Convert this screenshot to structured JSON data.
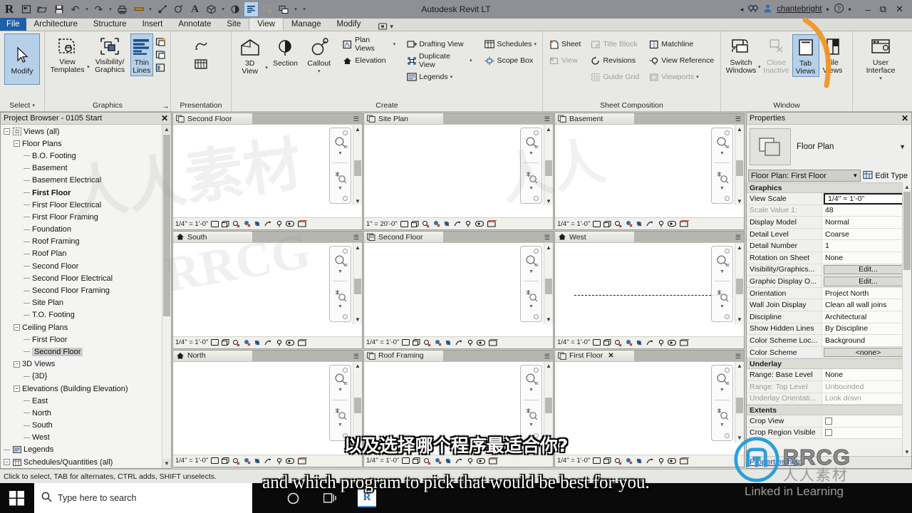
{
  "window": {
    "app_title": "Autodesk Revit LT",
    "user_name": "chantebright",
    "minimize": "–",
    "restore": "❐",
    "close": "✕",
    "help_icon": "?",
    "search_icon": "search-icon"
  },
  "quick_access": {
    "items": [
      {
        "name": "revit-logo",
        "glyph": "R"
      },
      {
        "name": "new-icon",
        "glyph": "◱"
      },
      {
        "name": "open-icon",
        "glyph": "☁"
      },
      {
        "name": "save-icon",
        "glyph": "Ὃe"
      },
      {
        "name": "undo-icon",
        "glyph": "↶"
      },
      {
        "name": "redo-icon",
        "glyph": "↷"
      },
      {
        "name": "print-icon",
        "glyph": "⎙"
      },
      {
        "name": "measure-icon",
        "glyph": "↔"
      },
      {
        "name": "aligned-dimension-icon",
        "glyph": "↗"
      },
      {
        "name": "tag-icon",
        "glyph": "℘"
      },
      {
        "name": "text-icon",
        "glyph": "A"
      },
      {
        "name": "default-3d-view-icon",
        "glyph": "⬡"
      },
      {
        "name": "section-icon",
        "glyph": "◔"
      },
      {
        "name": "thin-lines-icon",
        "glyph": "☰"
      },
      {
        "name": "close-hidden-windows-icon",
        "glyph": "❑"
      },
      {
        "name": "switch-windows-icon",
        "glyph": "⧉"
      },
      {
        "name": "customize-qat-icon",
        "glyph": "▾"
      }
    ]
  },
  "ribbon_tabs": {
    "file": "File",
    "items": [
      "Architecture",
      "Structure",
      "Insert",
      "Annotate",
      "Site",
      "View",
      "Manage",
      "Modify"
    ],
    "active": "View",
    "contextual_glyph": "▣"
  },
  "ribbon": {
    "panels": [
      {
        "name": "select",
        "title": "Select",
        "has_dropdown": true,
        "buttons": [
          {
            "label_line1": "Modify",
            "label_line2": "",
            "active": true,
            "icon": "arrow-cursor-icon"
          }
        ]
      },
      {
        "name": "graphics",
        "title": "Graphics",
        "has_launcher": true,
        "buttons": [
          {
            "label_line1": "View",
            "label_line2": "Templates",
            "active": false,
            "icon": "view-templates-icon",
            "caret": true
          },
          {
            "label_line1": "Visibility/",
            "label_line2": "Graphics",
            "active": false,
            "icon": "visibility-graphics-icon"
          },
          {
            "label_line1": "Thin",
            "label_line2": "Lines",
            "active": true,
            "icon": "thin-lines-icon"
          }
        ],
        "stack": [
          "show-hidden-lines-icon",
          "remove-hidden-lines-icon",
          "cut-profile-icon"
        ]
      },
      {
        "name": "presentation",
        "title": "Presentation",
        "stack": [
          "render-icon",
          "render-gallery-icon"
        ]
      },
      {
        "name": "create",
        "title": "Create",
        "buttons": [
          {
            "label_line1": "3D",
            "label_line2": "View",
            "icon": "3d-view-icon",
            "caret": true
          },
          {
            "label_line1": "Section",
            "label_line2": "",
            "icon": "section-icon"
          },
          {
            "label_line1": "Callout",
            "label_line2": "",
            "icon": "callout-icon",
            "caret": true
          }
        ],
        "small_cols": [
          [
            {
              "label": "Plan Views",
              "icon": "plan-views-icon",
              "caret": true,
              "dim": false
            },
            {
              "label": "Elevation",
              "icon": "elevation-icon",
              "caret": false,
              "dim": false
            }
          ],
          [
            {
              "label": "Drafting View",
              "icon": "drafting-view-icon",
              "caret": false,
              "dim": false
            },
            {
              "label": "Duplicate View",
              "icon": "duplicate-view-icon",
              "caret": true,
              "dim": false
            },
            {
              "label": "Legends",
              "icon": "legends-icon",
              "caret": true,
              "dim": false
            }
          ],
          [
            {
              "label": "Schedules",
              "icon": "schedules-icon",
              "caret": true,
              "dim": false
            },
            {
              "label": "Scope Box",
              "icon": "scope-box-icon",
              "caret": false,
              "dim": false
            }
          ]
        ]
      },
      {
        "name": "sheet-composition",
        "title": "Sheet Composition",
        "small_cols": [
          [
            {
              "label": "Sheet",
              "icon": "sheet-icon",
              "caret": false,
              "dim": false
            },
            {
              "label": "View",
              "icon": "view-icon",
              "caret": false,
              "dim": true
            }
          ],
          [
            {
              "label": "Title Block",
              "icon": "title-block-icon",
              "caret": false,
              "dim": true
            },
            {
              "label": "Revisions",
              "icon": "revisions-icon",
              "caret": false,
              "dim": false
            },
            {
              "label": "Guide Grid",
              "icon": "guide-grid-icon",
              "caret": false,
              "dim": true
            }
          ],
          [
            {
              "label": "Matchline",
              "icon": "matchline-icon",
              "caret": false,
              "dim": false
            },
            {
              "label": "View Reference",
              "icon": "view-reference-icon",
              "caret": false,
              "dim": false
            },
            {
              "label": "Viewports",
              "icon": "viewports-icon",
              "caret": true,
              "dim": true
            }
          ]
        ]
      },
      {
        "name": "window",
        "title": "Window",
        "buttons": [
          {
            "label_line1": "Switch",
            "label_line2": "Windows",
            "icon": "switch-windows-icon",
            "caret": true
          },
          {
            "label_line1": "Close",
            "label_line2": "Inactive",
            "icon": "close-inactive-icon",
            "dim": true
          },
          {
            "label_line1": "Tab",
            "label_line2": "Views",
            "icon": "tab-views-icon",
            "active": true
          },
          {
            "label_line1": "Tile",
            "label_line2": "Views",
            "icon": "tile-views-icon"
          }
        ]
      },
      {
        "name": "user-interface",
        "title": "",
        "buttons": [
          {
            "label_line1": "User",
            "label_line2": "Interface",
            "icon": "user-interface-icon",
            "caret": true
          }
        ]
      }
    ]
  },
  "browser": {
    "title": "Project Browser - 0105 Start",
    "close_glyph": "✕",
    "nodes": [
      {
        "label": "Views (all)",
        "depth": 0,
        "expander": "−",
        "icon": "views-all-icon",
        "bold": false,
        "selected": false
      },
      {
        "label": "Floor Plans",
        "depth": 1,
        "expander": "−",
        "icon": "",
        "bold": false,
        "selected": false
      },
      {
        "label": "B.O. Footing",
        "depth": 2,
        "expander": "",
        "icon": "",
        "bold": false,
        "selected": false
      },
      {
        "label": "Basement",
        "depth": 2,
        "expander": "",
        "icon": "",
        "bold": false,
        "selected": false
      },
      {
        "label": "Basement Electrical",
        "depth": 2,
        "expander": "",
        "icon": "",
        "bold": false,
        "selected": false
      },
      {
        "label": "First Floor",
        "depth": 2,
        "expander": "",
        "icon": "",
        "bold": true,
        "selected": false
      },
      {
        "label": "First Floor Electrical",
        "depth": 2,
        "expander": "",
        "icon": "",
        "bold": false,
        "selected": false
      },
      {
        "label": "First Floor Framing",
        "depth": 2,
        "expander": "",
        "icon": "",
        "bold": false,
        "selected": false
      },
      {
        "label": "Foundation",
        "depth": 2,
        "expander": "",
        "icon": "",
        "bold": false,
        "selected": false
      },
      {
        "label": "Roof Framing",
        "depth": 2,
        "expander": "",
        "icon": "",
        "bold": false,
        "selected": false
      },
      {
        "label": "Roof Plan",
        "depth": 2,
        "expander": "",
        "icon": "",
        "bold": false,
        "selected": false
      },
      {
        "label": "Second Floor",
        "depth": 2,
        "expander": "",
        "icon": "",
        "bold": false,
        "selected": false
      },
      {
        "label": "Second Floor Electrical",
        "depth": 2,
        "expander": "",
        "icon": "",
        "bold": false,
        "selected": false
      },
      {
        "label": "Second Floor Framing",
        "depth": 2,
        "expander": "",
        "icon": "",
        "bold": false,
        "selected": false
      },
      {
        "label": "Site Plan",
        "depth": 2,
        "expander": "",
        "icon": "",
        "bold": false,
        "selected": false
      },
      {
        "label": "T.O. Footing",
        "depth": 2,
        "expander": "",
        "icon": "",
        "bold": false,
        "selected": false
      },
      {
        "label": "Ceiling Plans",
        "depth": 1,
        "expander": "−",
        "icon": "",
        "bold": false,
        "selected": false
      },
      {
        "label": "First Floor",
        "depth": 2,
        "expander": "",
        "icon": "",
        "bold": false,
        "selected": false
      },
      {
        "label": "Second Floor",
        "depth": 2,
        "expander": "",
        "icon": "",
        "bold": false,
        "selected": true
      },
      {
        "label": "3D Views",
        "depth": 1,
        "expander": "−",
        "icon": "",
        "bold": false,
        "selected": false
      },
      {
        "label": "{3D}",
        "depth": 2,
        "expander": "",
        "icon": "",
        "bold": false,
        "selected": false
      },
      {
        "label": "Elevations (Building Elevation)",
        "depth": 1,
        "expander": "−",
        "icon": "",
        "bold": false,
        "selected": false
      },
      {
        "label": "East",
        "depth": 2,
        "expander": "",
        "icon": "",
        "bold": false,
        "selected": false
      },
      {
        "label": "North",
        "depth": 2,
        "expander": "",
        "icon": "",
        "bold": false,
        "selected": false
      },
      {
        "label": "South",
        "depth": 2,
        "expander": "",
        "icon": "",
        "bold": false,
        "selected": false
      },
      {
        "label": "West",
        "depth": 2,
        "expander": "",
        "icon": "",
        "bold": false,
        "selected": false
      },
      {
        "label": "Legends",
        "depth": 0,
        "expander": "",
        "icon": "legends-icon",
        "bold": false,
        "selected": false
      },
      {
        "label": "Schedules/Quantities (all)",
        "depth": 0,
        "expander": "−",
        "icon": "schedules-icon",
        "bold": false,
        "selected": false
      }
    ]
  },
  "views": [
    {
      "title": "Second Floor",
      "icon": "floor-plan-icon",
      "scale": "1/4\" = 1'-0\"",
      "closeable": false,
      "has_line": false
    },
    {
      "title": "Site Plan",
      "icon": "floor-plan-icon",
      "scale": "1\" = 20'-0\"",
      "closeable": false,
      "has_line": false
    },
    {
      "title": "Basement",
      "icon": "floor-plan-icon",
      "scale": "1/4\" = 1'-0\"",
      "closeable": false,
      "has_line": false
    },
    {
      "title": "South",
      "icon": "elevation-icon",
      "scale": "1/4\" = 1'-0\"",
      "closeable": false,
      "has_line": false
    },
    {
      "title": "Second Floor",
      "icon": "ceiling-plan-icon",
      "scale": "1/4\" = 1'-0\"",
      "closeable": false,
      "has_line": false
    },
    {
      "title": "West",
      "icon": "elevation-icon",
      "scale": "1/4\" = 1'-0\"",
      "closeable": false,
      "has_line": true
    },
    {
      "title": "North",
      "icon": "elevation-icon",
      "scale": "1/4\" = 1'-0\"",
      "closeable": false,
      "has_line": false
    },
    {
      "title": "Roof Framing",
      "icon": "floor-plan-icon",
      "scale": "1/4\" = 1'-0\"",
      "closeable": false,
      "has_line": false
    },
    {
      "title": "First Floor",
      "icon": "floor-plan-icon",
      "scale": "1/4\" = 1'-0\"",
      "closeable": true,
      "has_line": false
    }
  ],
  "view_control_icons": [
    "detail-level-icon",
    "visual-style-icon",
    "sun-path-icon",
    "shadows-icon",
    "rendering-dialog-icon",
    "crop-view-icon",
    "show-crop-icon",
    "temporary-hide-isolate-icon",
    "reveal-hidden-elements-icon"
  ],
  "properties": {
    "title": "Properties",
    "close_glyph": "✕",
    "type_name": "Floor Plan",
    "selector_value": "Floor Plan: First Floor",
    "edit_type_label": "Edit Type",
    "groups": [
      {
        "name": "Graphics",
        "rows": [
          {
            "key": "View Scale",
            "value": "1/4\" = 1'-0\"",
            "style": "boxed",
            "key_dim": false,
            "val_dim": false
          },
          {
            "key": "Scale Value    1:",
            "value": "48",
            "style": "plain",
            "key_dim": true,
            "val_dim": false
          },
          {
            "key": "Display Model",
            "value": "Normal",
            "style": "plain",
            "key_dim": false,
            "val_dim": false
          },
          {
            "key": "Detail Level",
            "value": "Coarse",
            "style": "plain",
            "key_dim": false,
            "val_dim": false
          },
          {
            "key": "Detail Number",
            "value": "1",
            "style": "plain",
            "key_dim": false,
            "val_dim": false
          },
          {
            "key": "Rotation on Sheet",
            "value": "None",
            "style": "plain",
            "key_dim": false,
            "val_dim": false
          },
          {
            "key": "Visibility/Graphics...",
            "value": "Edit...",
            "style": "button",
            "key_dim": false,
            "val_dim": false
          },
          {
            "key": "Graphic Display O...",
            "value": "Edit...",
            "style": "button",
            "key_dim": false,
            "val_dim": false
          },
          {
            "key": "Orientation",
            "value": "Project North",
            "style": "plain",
            "key_dim": false,
            "val_dim": false
          },
          {
            "key": "Wall Join Display",
            "value": "Clean all wall joins",
            "style": "plain",
            "key_dim": false,
            "val_dim": false
          },
          {
            "key": "Discipline",
            "value": "Architectural",
            "style": "plain",
            "key_dim": false,
            "val_dim": false
          },
          {
            "key": "Show Hidden Lines",
            "value": "By Discipline",
            "style": "plain",
            "key_dim": false,
            "val_dim": false
          },
          {
            "key": "Color Scheme Loc...",
            "value": "Background",
            "style": "plain",
            "key_dim": false,
            "val_dim": false
          },
          {
            "key": "Color Scheme",
            "value": "<none>",
            "style": "button",
            "key_dim": false,
            "val_dim": false
          }
        ]
      },
      {
        "name": "Underlay",
        "rows": [
          {
            "key": "Range: Base Level",
            "value": "None",
            "style": "plain",
            "key_dim": false,
            "val_dim": false
          },
          {
            "key": "Range: Top Level",
            "value": "Unbounded",
            "style": "plain",
            "key_dim": true,
            "val_dim": true
          },
          {
            "key": "Underlay Orientati...",
            "value": "Look down",
            "style": "plain",
            "key_dim": true,
            "val_dim": true
          }
        ]
      },
      {
        "name": "Extents",
        "rows": [
          {
            "key": "Crop View",
            "value": "",
            "style": "check",
            "key_dim": false,
            "val_dim": false
          },
          {
            "key": "Crop Region Visible",
            "value": "",
            "style": "check",
            "key_dim": false,
            "val_dim": false
          }
        ]
      }
    ],
    "footer_link": "Properties help"
  },
  "status_bar": {
    "text": "Click to select, TAB for alternates, CTRL adds, SHIFT unselects."
  },
  "taskbar": {
    "start_icon": "windows-start-icon",
    "search_placeholder": "Type here to search",
    "search_icon": "search-icon",
    "items": [
      {
        "name": "cortana-icon",
        "glyph": "○"
      },
      {
        "name": "task-view-icon",
        "glyph": "⌸"
      },
      {
        "name": "revit-taskbar-icon",
        "glyph": "R"
      }
    ]
  },
  "subtitles": {
    "chinese": "以及选择哪个程序最适合你?",
    "english": "and which program to pick that would be best for you."
  },
  "watermark": {
    "brand": "RRCG",
    "brand_cn": "人人素材",
    "platform": "Linked in Learning"
  },
  "colors": {
    "accent_blue": "#1f5fa9",
    "highlight": "#b5d0e8",
    "titlebar": "#8f9096",
    "ribbon_bg": "#e8e8e4",
    "link": "#1551a8"
  }
}
